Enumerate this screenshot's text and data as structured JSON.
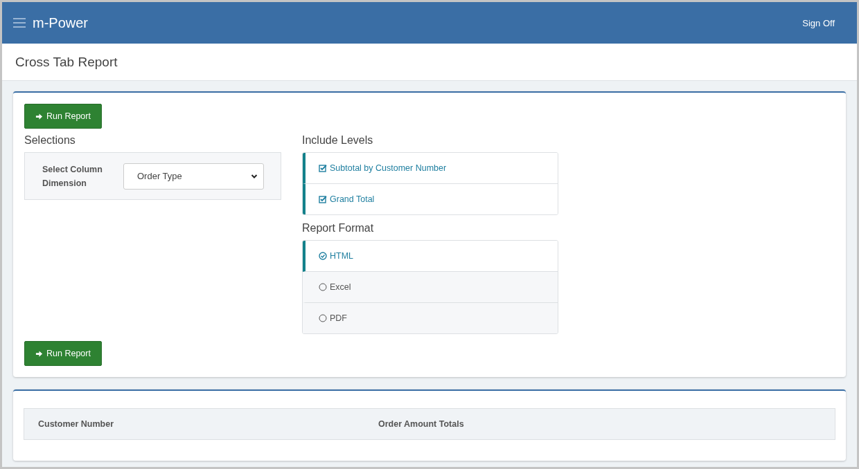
{
  "header": {
    "brand": "m-Power",
    "sign_off": "Sign Off"
  },
  "page_title": "Cross Tab Report",
  "run_buttons": [
    "Run Report",
    "Run Report"
  ],
  "selections": {
    "title": "Selections",
    "field_label": "Select Column Dimension",
    "value": "Order Type"
  },
  "include_levels": {
    "title": "Include Levels",
    "items": [
      {
        "label": "Subtotal by Customer Number",
        "checked": true
      },
      {
        "label": "Grand Total",
        "checked": true
      }
    ]
  },
  "report_format": {
    "title": "Report Format",
    "items": [
      {
        "label": "HTML",
        "selected": true
      },
      {
        "label": "Excel",
        "selected": false
      },
      {
        "label": "PDF",
        "selected": false
      }
    ]
  },
  "table": {
    "columns": [
      "Customer Number",
      "Order Amount Totals"
    ]
  }
}
